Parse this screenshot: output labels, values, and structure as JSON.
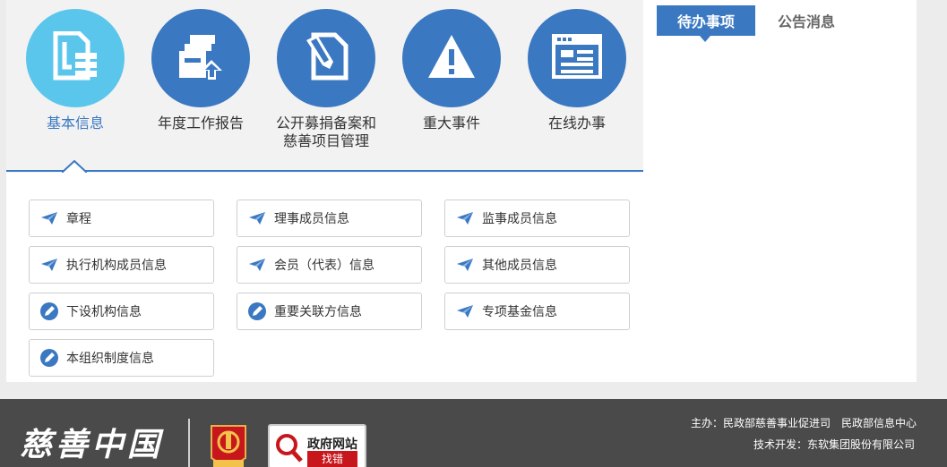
{
  "nav": {
    "items": [
      {
        "label_line1": "基本信息",
        "label_line2": "",
        "icon": "document-icon",
        "active": true
      },
      {
        "label_line1": "年度工作报告",
        "label_line2": "",
        "icon": "report-upload-icon",
        "active": false
      },
      {
        "label_line1": "公开募捐备案和",
        "label_line2": "慈善项目管理",
        "icon": "edit-document-icon",
        "active": false
      },
      {
        "label_line1": "重大事件",
        "label_line2": "",
        "icon": "warning-icon",
        "active": false
      },
      {
        "label_line1": "在线办事",
        "label_line2": "",
        "icon": "browser-window-icon",
        "active": false
      }
    ]
  },
  "items": [
    {
      "label": "章程",
      "icon": "paper-plane-icon"
    },
    {
      "label": "理事成员信息",
      "icon": "paper-plane-icon"
    },
    {
      "label": "监事成员信息",
      "icon": "paper-plane-icon"
    },
    {
      "label": "执行机构成员信息",
      "icon": "paper-plane-icon"
    },
    {
      "label": "会员（代表）信息",
      "icon": "paper-plane-icon"
    },
    {
      "label": "其他成员信息",
      "icon": "paper-plane-icon"
    },
    {
      "label": "下设机构信息",
      "icon": "pen-circle-icon"
    },
    {
      "label": "重要关联方信息",
      "icon": "pen-circle-icon"
    },
    {
      "label": "专项基金信息",
      "icon": "paper-plane-icon"
    },
    {
      "label": "本组织制度信息",
      "icon": "pen-circle-icon"
    }
  ],
  "side_tabs": {
    "todo": "待办事项",
    "notice": "公告消息"
  },
  "footer": {
    "logo_text": "慈善中国",
    "gov_badge_title": "政府网站",
    "gov_badge_sub": "找错",
    "info_line1": "主办：民政部慈善事业促进司　民政部信息中心",
    "info_line2": "技术开发：东软集团股份有限公司"
  },
  "colors": {
    "primary": "#3a78c2",
    "active_circle": "#5bc6ec",
    "footer_bg": "#4a4a4a"
  }
}
